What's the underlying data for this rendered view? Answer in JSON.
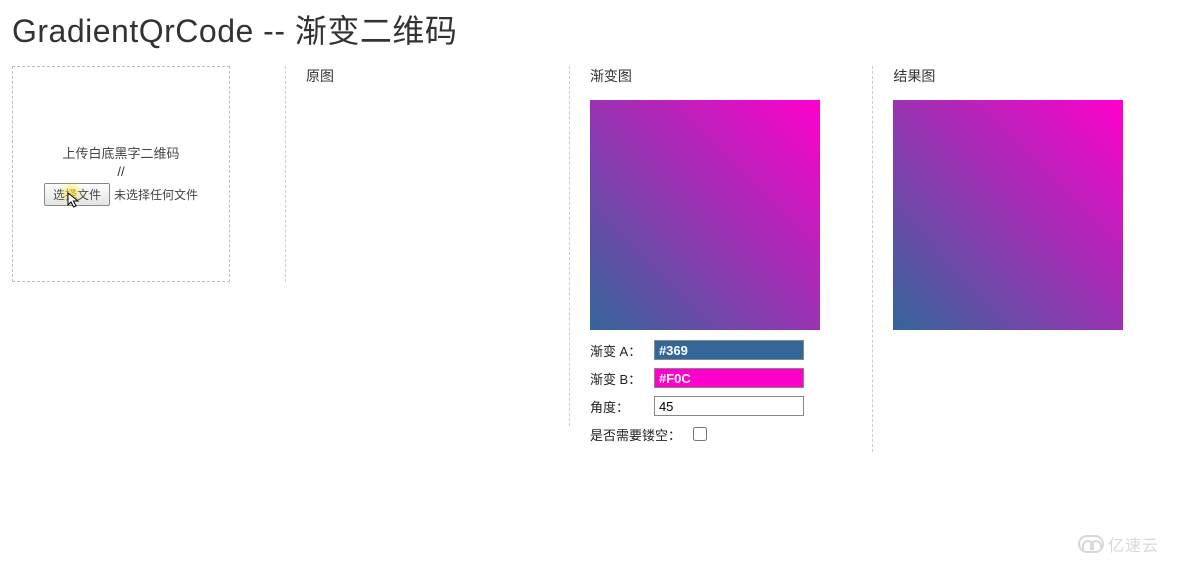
{
  "title": "GradientQrCode -- 渐变二维码",
  "upload": {
    "hint": "上传白底黑字二维码",
    "slashes": "//",
    "choose_btn": "选择文件",
    "no_file": "未选择任何文件"
  },
  "columns": {
    "original": "原图",
    "gradient": "渐变图",
    "result": "结果图"
  },
  "gradient": {
    "colorA_label": "渐变 A：",
    "colorA_value": "#369",
    "colorB_label": "渐变 B：",
    "colorB_value": "#F0C",
    "angle_label": "角度：",
    "angle_value": "45",
    "hollow_label": "是否需要镂空：",
    "hollow_checked": false
  },
  "colors": {
    "gradA": "#336699",
    "gradB": "#FF00CC"
  },
  "watermark": "亿速云"
}
